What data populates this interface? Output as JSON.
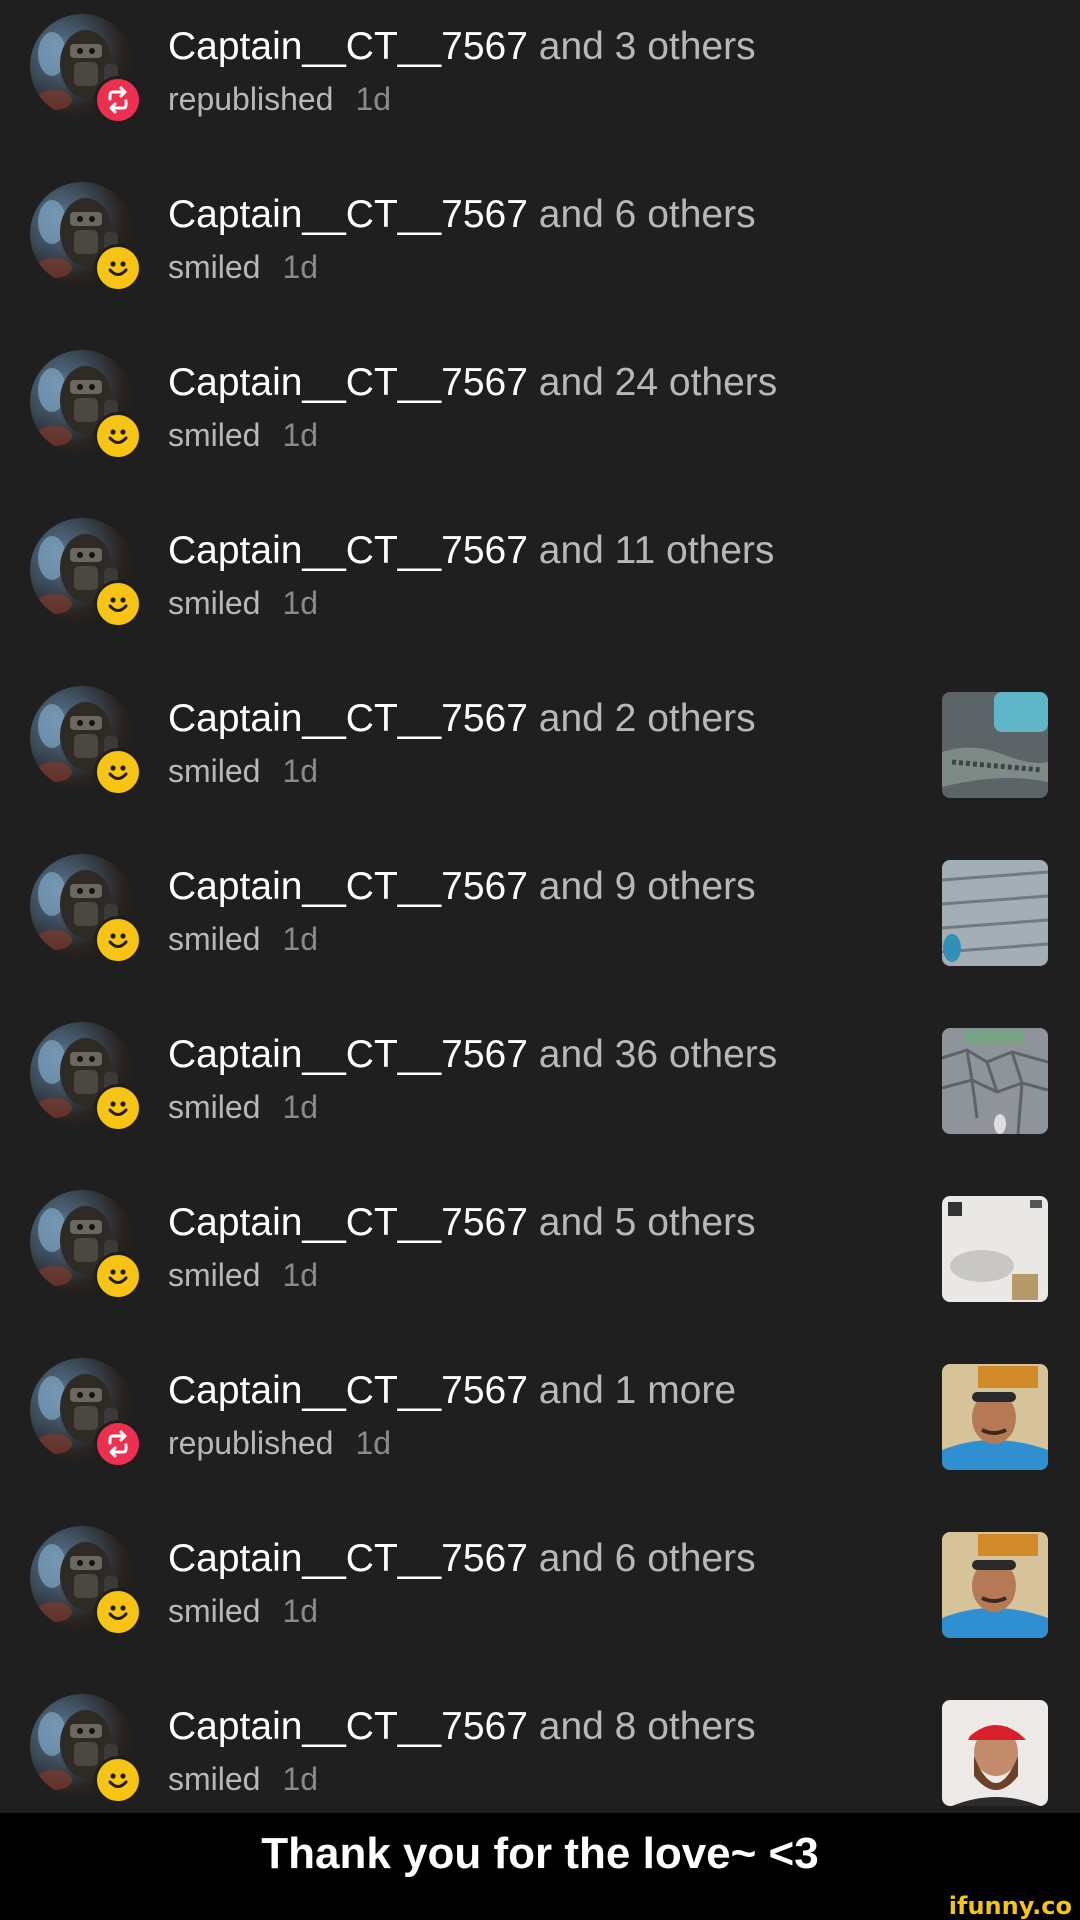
{
  "colors": {
    "background": "#1f1f1f",
    "smile_badge": "#f6c414",
    "republish_badge": "#ec3150",
    "caption_bar": "#000000",
    "watermark": "#f6c414"
  },
  "notifications": [
    {
      "user": "Captain__CT__7567",
      "rest": " and 3 others",
      "action": "republished",
      "time": "1d",
      "badge": "republish-icon",
      "thumb": null
    },
    {
      "user": "Captain__CT__7567",
      "rest": " and 6 others",
      "action": "smiled",
      "time": "1d",
      "badge": "smile-icon",
      "thumb": null
    },
    {
      "user": "Captain__CT__7567",
      "rest": " and 24 others",
      "action": "smiled",
      "time": "1d",
      "badge": "smile-icon",
      "thumb": null
    },
    {
      "user": "Captain__CT__7567",
      "rest": " and 11 others",
      "action": "smiled",
      "time": "1d",
      "badge": "smile-icon",
      "thumb": null
    },
    {
      "user": "Captain__CT__7567",
      "rest": " and 2 others",
      "action": "smiled",
      "time": "1d",
      "badge": "smile-icon",
      "thumb": "lizard-photo"
    },
    {
      "user": "Captain__CT__7567",
      "rest": " and 9 others",
      "action": "smiled",
      "time": "1d",
      "badge": "smile-icon",
      "thumb": "wood-deck-photo"
    },
    {
      "user": "Captain__CT__7567",
      "rest": " and 36 others",
      "action": "smiled",
      "time": "1d",
      "badge": "smile-icon",
      "thumb": "stone-path-photo"
    },
    {
      "user": "Captain__CT__7567",
      "rest": " and 5 others",
      "action": "smiled",
      "time": "1d",
      "badge": "smile-icon",
      "thumb": "white-room-photo"
    },
    {
      "user": "Captain__CT__7567",
      "rest": " and 1 more",
      "action": "republished",
      "time": "1d",
      "badge": "republish-icon",
      "thumb": "man-selfie-photo"
    },
    {
      "user": "Captain__CT__7567",
      "rest": " and 6 others",
      "action": "smiled",
      "time": "1d",
      "badge": "smile-icon",
      "thumb": "man-selfie-photo"
    },
    {
      "user": "Captain__CT__7567",
      "rest": " and 8 others",
      "action": "smiled",
      "time": "1d",
      "badge": "smile-icon",
      "thumb": "red-cap-man-photo"
    }
  ],
  "caption": "Thank you for the love~ <3",
  "watermark": "ifunny.co"
}
